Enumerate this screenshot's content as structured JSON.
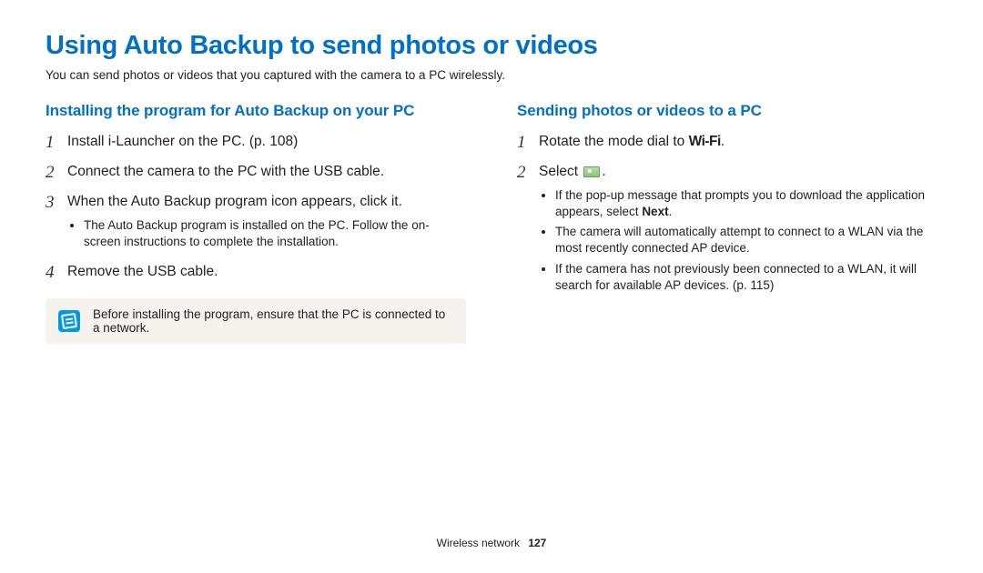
{
  "title": "Using Auto Backup to send photos or videos",
  "intro": "You can send photos or videos that you captured with the camera to a PC wirelessly.",
  "left": {
    "heading": "Installing the program for Auto Backup on your PC",
    "steps": [
      {
        "num": "1",
        "text": "Install i-Launcher on the PC. (p. 108)"
      },
      {
        "num": "2",
        "text": "Connect the camera to the PC with the USB cable."
      },
      {
        "num": "3",
        "text": "When the Auto Backup program icon appears, click it.",
        "bullets": [
          "The Auto Backup program is installed on the PC. Follow the on-screen instructions to complete the installation."
        ]
      },
      {
        "num": "4",
        "text": "Remove the USB cable."
      }
    ],
    "note": "Before installing the program, ensure that the PC is connected to a network."
  },
  "right": {
    "heading": "Sending photos or videos to a PC",
    "steps": [
      {
        "num": "1",
        "prefix": "Rotate the mode dial to ",
        "wifi": "Wi-Fi",
        "suffix": "."
      },
      {
        "num": "2",
        "prefix": "Select ",
        "icon": "pc-backup-icon",
        "suffix": ".",
        "bullets_html": [
          {
            "pre": "If the pop-up message that prompts you to download the application appears, select ",
            "bold": "Next",
            "post": "."
          },
          {
            "pre": "The camera will automatically attempt to connect to a WLAN via the most recently connected AP device.",
            "bold": "",
            "post": ""
          },
          {
            "pre": "If the camera has not previously been connected to a WLAN, it will search for available AP devices. (p. 115)",
            "bold": "",
            "post": ""
          }
        ]
      }
    ]
  },
  "footer": {
    "section": "Wireless network",
    "page": "127"
  }
}
